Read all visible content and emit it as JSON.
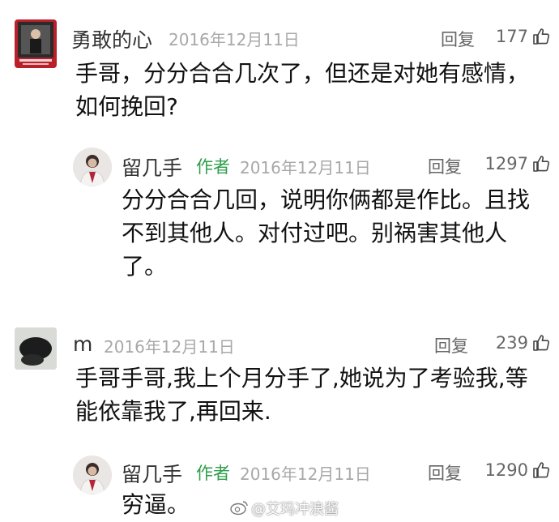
{
  "comments": [
    {
      "name": "勇敢的心",
      "date": "2016年12月11日",
      "reply": "回复",
      "likes": "177",
      "text": "手哥，分分合合几次了，但还是对她有感情，\n如何挽回?"
    },
    {
      "name": "留几手",
      "author_badge": "作者",
      "date": "2016年12月11日",
      "reply": "回复",
      "likes": "1297",
      "text": "分分合合几回，说明你俩都是作比。且找\n不到其他人。对付过吧。别祸害其他人\n了。"
    },
    {
      "name": "m",
      "date": "2016年12月11日",
      "reply": "回复",
      "likes": "239",
      "text": "手哥手哥,我上个月分手了,她说为了考验我,等\n能依靠我了,再回来."
    },
    {
      "name": "留几手",
      "author_badge": "作者",
      "date": "2016年12月11日",
      "reply": "回复",
      "likes": "1290",
      "text": "穷逼。"
    }
  ],
  "watermark": "@艾玛冲浪酱",
  "colors": {
    "author_badge": "#2e9e4a",
    "meta": "#a8a8a8",
    "text": "#111111"
  }
}
